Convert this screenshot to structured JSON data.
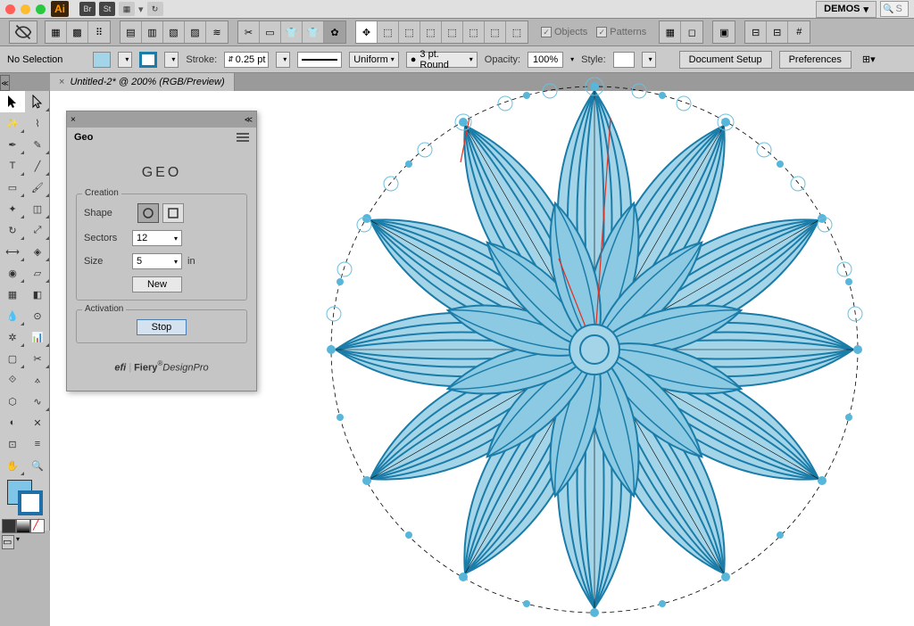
{
  "titlebar": {
    "demos": "DEMOS",
    "app": "Ai",
    "br": "Br",
    "st": "St",
    "search_placeholder": "S"
  },
  "controlbar": {
    "selection": "No Selection",
    "stroke_label": "Stroke:",
    "stroke_weight": "0.25 pt",
    "profile": "Uniform",
    "brush": "3 pt. Round",
    "opacity_label": "Opacity:",
    "opacity_value": "100%",
    "style_label": "Style:",
    "doc_setup": "Document Setup",
    "preferences": "Preferences"
  },
  "toolbar_checks": {
    "objects": "Objects",
    "patterns": "Patterns"
  },
  "tab": {
    "title": "Untitled-2* @ 200% (RGB/Preview)"
  },
  "geo": {
    "tab": "Geo",
    "title": "GEO",
    "section_creation": "Creation",
    "section_activation": "Activation",
    "shape_label": "Shape",
    "sectors_label": "Sectors",
    "sectors_value": "12",
    "size_label": "Size",
    "size_value": "5",
    "size_unit": "in",
    "new_btn": "New",
    "stop_btn": "Stop",
    "logo_efi": "efi",
    "logo_fiery": "Fiery",
    "logo_dp": "DesignPro"
  },
  "colors": {
    "fill": "#7fc5e8",
    "stroke": "#1f6fa8",
    "art_light": "#a3d4e8",
    "art_dark": "#1a7ca8"
  }
}
